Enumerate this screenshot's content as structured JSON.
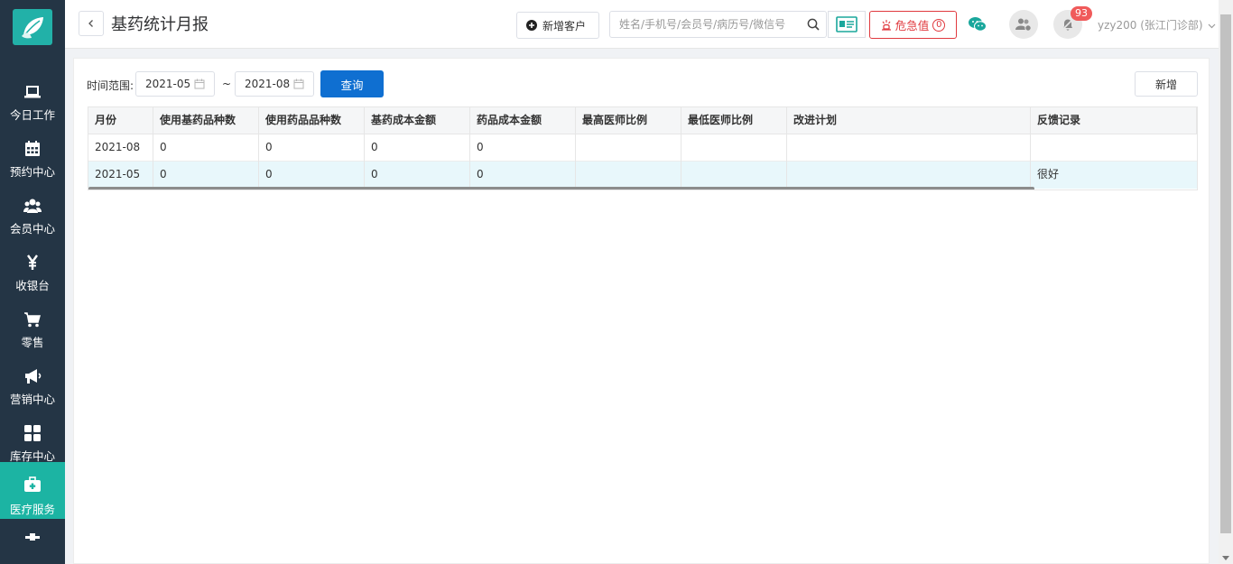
{
  "sidebar": {
    "items": [
      {
        "label": "今日工作",
        "icon": "laptop-icon"
      },
      {
        "label": "预约中心",
        "icon": "calendar-icon"
      },
      {
        "label": "会员中心",
        "icon": "users-icon"
      },
      {
        "label": "收银台",
        "icon": "yen-icon"
      },
      {
        "label": "零售",
        "icon": "cart-icon"
      },
      {
        "label": "营销中心",
        "icon": "megaphone-icon"
      },
      {
        "label": "库存中心",
        "icon": "grid-icon"
      },
      {
        "label": "医疗服务",
        "icon": "medkit-icon"
      }
    ],
    "active_index": 7,
    "accent_color": "#1cb4a3",
    "background_color": "#243545"
  },
  "header": {
    "back_icon": "chevron-left-icon",
    "title": "基药统计月报",
    "add_customer_label": "新增客户",
    "search_placeholder": "姓名/手机号/会员号/病历号/微信号",
    "danger_label": "危急值",
    "danger_count": "0",
    "notification_count": "93",
    "user_label": "yzy200 (张江门诊部)"
  },
  "filter": {
    "range_label": "时间范围:",
    "start_date": "2021-05",
    "end_date": "2021-08",
    "separator": "~",
    "query_label": "查询",
    "add_label": "新增",
    "primary_color": "#0f6fd1"
  },
  "table": {
    "columns": [
      "月份",
      "使用基药品种数",
      "使用药品品种数",
      "基药成本金额",
      "药品成本金额",
      "最高医师比例",
      "最低医师比例",
      "改进计划",
      "反馈记录"
    ],
    "rows": [
      [
        "2021-08",
        "0",
        "0",
        "0",
        "0",
        "",
        "",
        "",
        ""
      ],
      [
        "2021-05",
        "0",
        "0",
        "0",
        "0",
        "",
        "",
        "",
        "很好"
      ]
    ],
    "selected_row_index": 1,
    "selected_row_color": "#e8f7fb"
  }
}
